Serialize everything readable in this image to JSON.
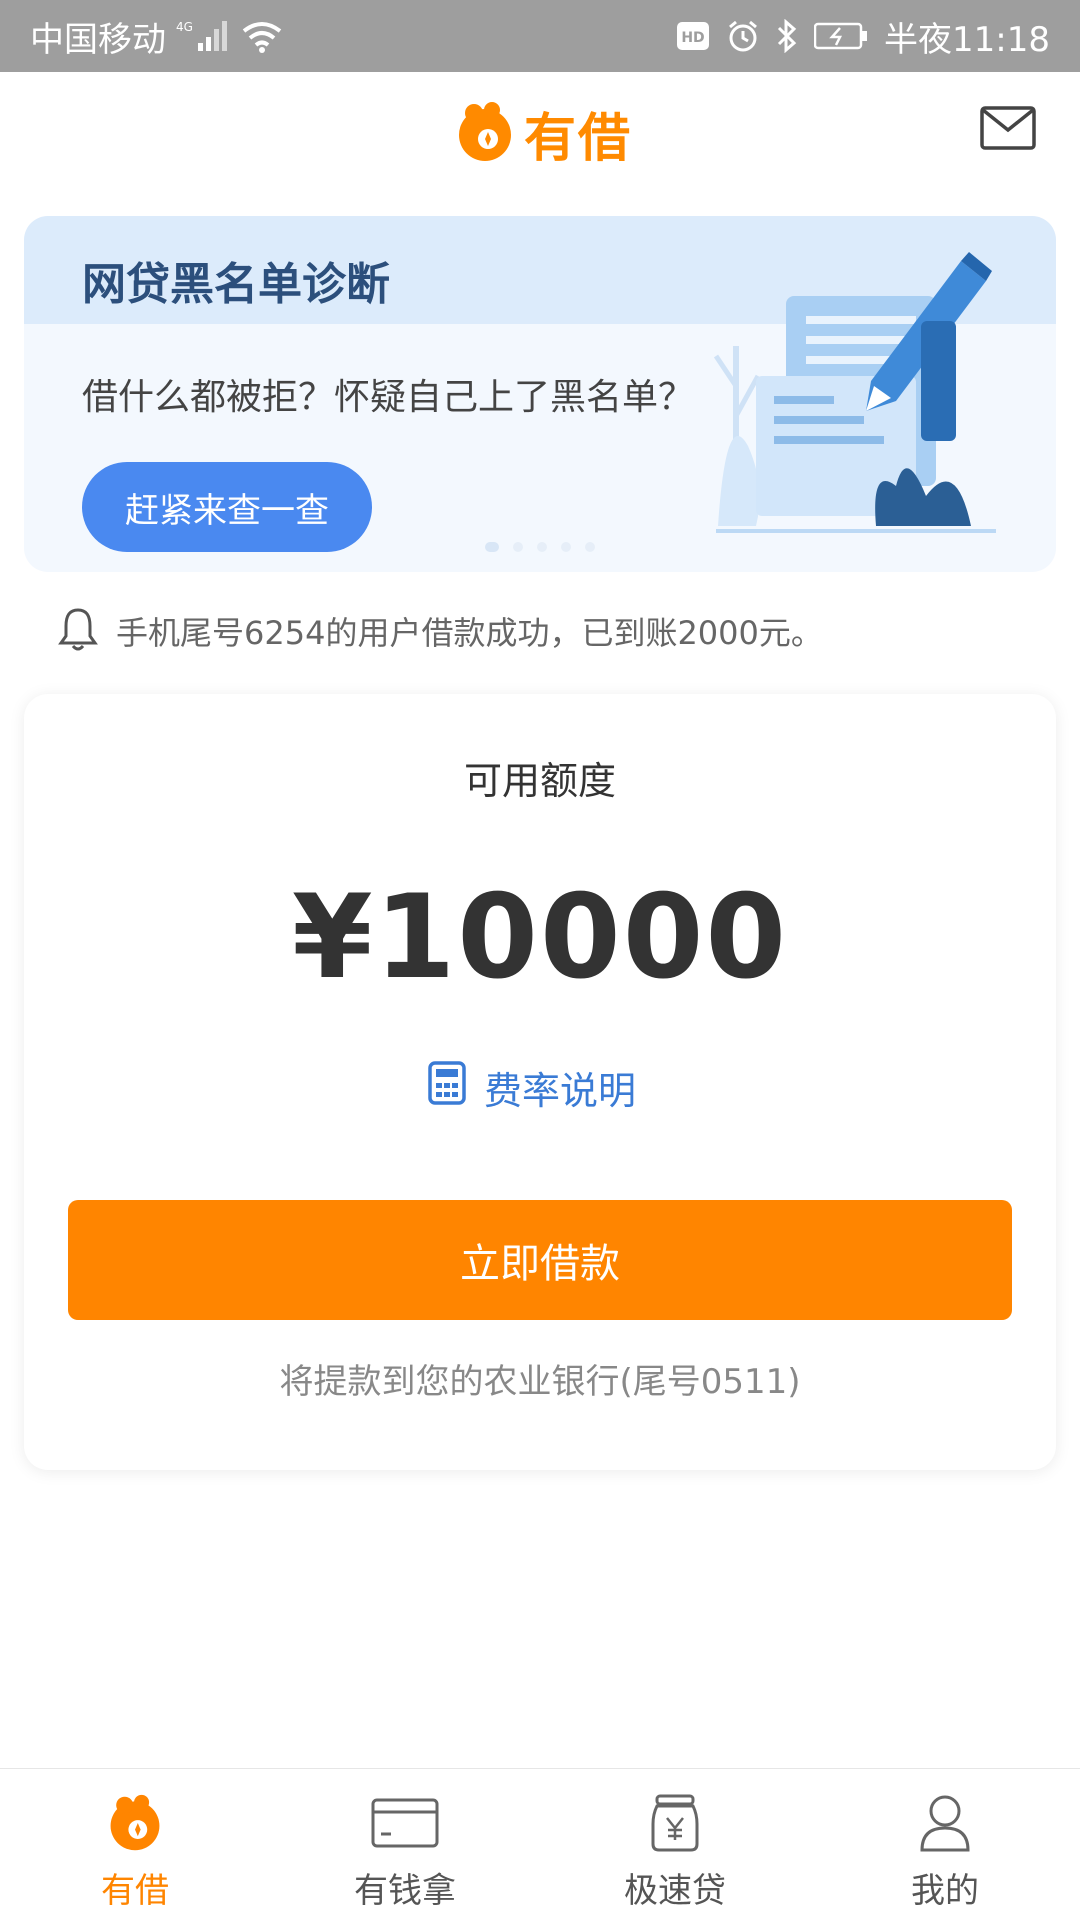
{
  "status_bar": {
    "carrier": "中国移动",
    "network": "4G",
    "time": "半夜11:18",
    "hd_label": "HD"
  },
  "header": {
    "logo_text": "有借",
    "mail_icon": "mail-icon"
  },
  "banner": {
    "title": "网贷黑名单诊断",
    "subtitle": "借什么都被拒？怀疑自己上了黑名单？",
    "button_label": "赶紧来查一查"
  },
  "notice": {
    "icon": "bell-icon",
    "text": "手机尾号6254的用户借款成功，已到账2000元。"
  },
  "quota_card": {
    "label": "可用额度",
    "amount": "¥10000",
    "rate_link": "费率说明",
    "borrow_button": "立即借款",
    "bank_note": "将提款到您的农业银行(尾号0511)"
  },
  "tabs": [
    {
      "label": "有借",
      "icon": "youjie-logo-icon",
      "active": true
    },
    {
      "label": "有钱拿",
      "icon": "card-icon",
      "active": false
    },
    {
      "label": "极速贷",
      "icon": "money-jar-icon",
      "active": false
    },
    {
      "label": "我的",
      "icon": "user-icon",
      "active": false
    }
  ],
  "colors": {
    "accent": "#ff8500",
    "link": "#3a7bd5",
    "banner_button": "#4a89f0"
  }
}
